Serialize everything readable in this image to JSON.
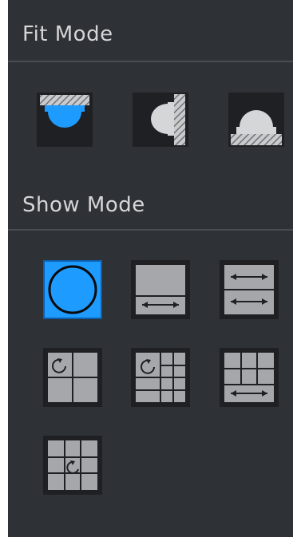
{
  "fit_mode": {
    "title": "Fit Mode",
    "buttons": [
      {
        "name": "ceiling-mount",
        "icon": "ceiling-mount-icon",
        "selected": false
      },
      {
        "name": "wall-mount",
        "icon": "wall-mount-icon",
        "selected": false
      },
      {
        "name": "ground-mount",
        "icon": "ground-mount-icon",
        "selected": false
      }
    ]
  },
  "show_mode": {
    "title": "Show Mode",
    "buttons": [
      {
        "name": "fisheye-original",
        "icon": "circle-view-icon",
        "selected": true
      },
      {
        "name": "panorama-single",
        "icon": "panorama-single-icon",
        "selected": false
      },
      {
        "name": "panorama-double",
        "icon": "panorama-double-icon",
        "selected": false
      },
      {
        "name": "fisheye-plus-3",
        "icon": "fisheye-plus-3-icon",
        "selected": false
      },
      {
        "name": "fisheye-plus-8",
        "icon": "fisheye-plus-8-icon",
        "selected": false
      },
      {
        "name": "panorama-plus-6",
        "icon": "panorama-plus-6-icon",
        "selected": false
      },
      {
        "name": "fisheye-grid-9",
        "icon": "fisheye-grid-9-icon",
        "selected": false
      }
    ]
  },
  "colors": {
    "panel_bg": "#2e3135",
    "button_bg": "#1e2023",
    "tile_gray": "#a5a7aa",
    "accent_blue": "#1e9bff",
    "title_text": "#d6d6d6"
  }
}
